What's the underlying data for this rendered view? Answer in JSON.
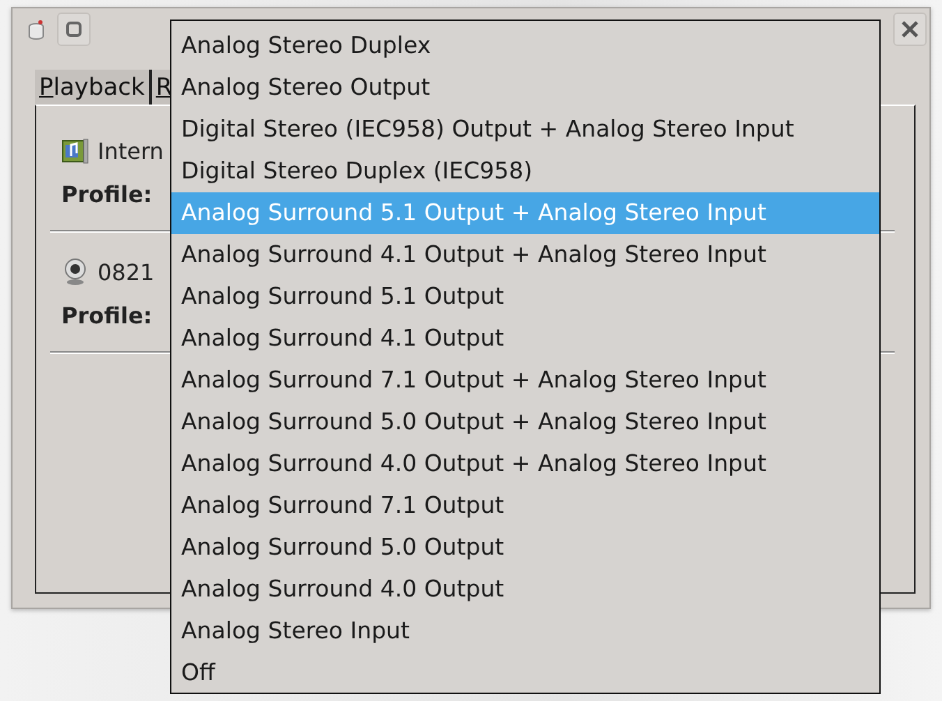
{
  "window": {
    "tabs": [
      "Playback",
      "R"
    ],
    "devices": [
      {
        "kind": "card",
        "name": "Intern",
        "profile_label": "Profile:"
      },
      {
        "kind": "webcam",
        "name": "0821",
        "profile_label": "Profile:"
      }
    ]
  },
  "profile_menu": {
    "items": [
      {
        "label": "Analog Stereo Duplex",
        "selected": false
      },
      {
        "label": "Analog Stereo Output",
        "selected": false
      },
      {
        "label": "Digital Stereo (IEC958) Output + Analog Stereo Input",
        "selected": false
      },
      {
        "label": "Digital Stereo Duplex (IEC958)",
        "selected": false
      },
      {
        "label": "Analog Surround 5.1 Output + Analog Stereo Input",
        "selected": true
      },
      {
        "label": "Analog Surround 4.1 Output + Analog Stereo Input",
        "selected": false
      },
      {
        "label": "Analog Surround 5.1 Output",
        "selected": false
      },
      {
        "label": "Analog Surround 4.1 Output",
        "selected": false
      },
      {
        "label": "Analog Surround 7.1 Output + Analog Stereo Input",
        "selected": false
      },
      {
        "label": "Analog Surround 5.0 Output + Analog Stereo Input",
        "selected": false
      },
      {
        "label": "Analog Surround 4.0 Output + Analog Stereo Input",
        "selected": false
      },
      {
        "label": "Analog Surround 7.1 Output",
        "selected": false
      },
      {
        "label": "Analog Surround 5.0 Output",
        "selected": false
      },
      {
        "label": "Analog Surround 4.0 Output",
        "selected": false
      },
      {
        "label": "Analog Stereo Input",
        "selected": false
      },
      {
        "label": "Off",
        "selected": false
      }
    ]
  }
}
